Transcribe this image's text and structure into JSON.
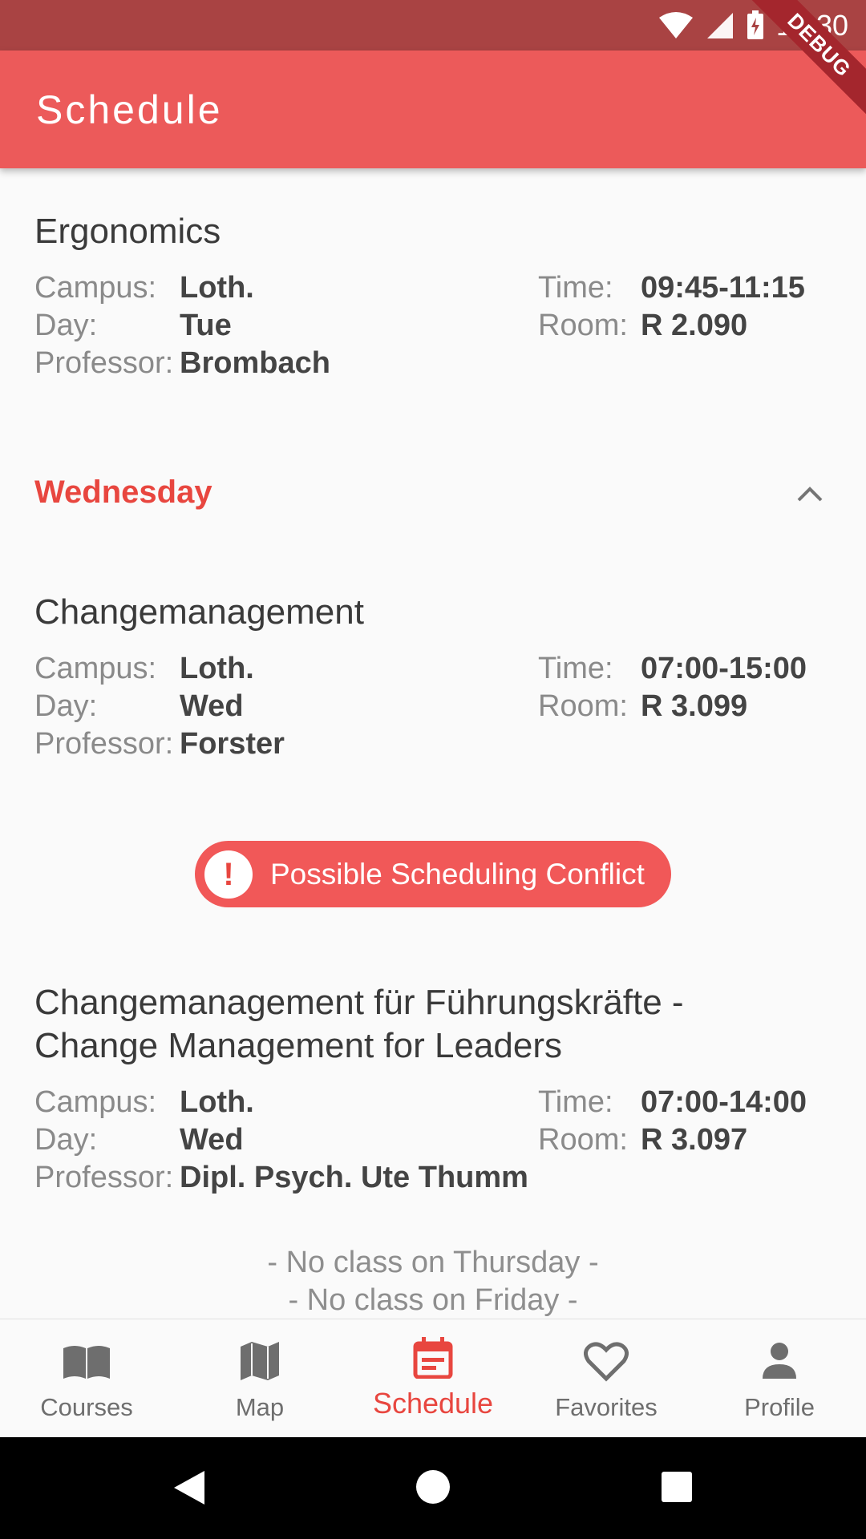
{
  "status_bar": {
    "time": "10:30",
    "debug_label": "DEBUG"
  },
  "app_bar": {
    "title": "Schedule"
  },
  "courses": [
    {
      "title": "Ergonomics",
      "campus_label": "Campus:",
      "campus": "Loth.",
      "day_label": "Day:",
      "day": "Tue",
      "professor_label": "Professor:",
      "professor": "Brombach",
      "time_label": "Time:",
      "time": "09:45-11:15",
      "room_label": "Room:",
      "room": "R 2.090"
    },
    {
      "title": "Changemanagement",
      "campus_label": "Campus:",
      "campus": "Loth.",
      "day_label": "Day:",
      "day": "Wed",
      "professor_label": "Professor:",
      "professor": "Forster",
      "time_label": "Time:",
      "time": "07:00-15:00",
      "room_label": "Room:",
      "room": "R 3.099"
    },
    {
      "title_line1": "Changemanagement für Führungskräfte -",
      "title_line2": "Change Management for Leaders",
      "campus_label": "Campus:",
      "campus": "Loth.",
      "day_label": "Day:",
      "day": "Wed",
      "professor_label": "Professor:",
      "professor": "Dipl. Psych. Ute  Thumm",
      "time_label": "Time:",
      "time": "07:00-14:00",
      "room_label": "Room:",
      "room": "R 3.097"
    }
  ],
  "day_section": {
    "label": "Wednesday"
  },
  "conflict": {
    "icon": "!",
    "text": "Possible Scheduling Conflict"
  },
  "no_class": [
    "- No class on Thursday -",
    "- No class on Friday -"
  ],
  "bottom_nav": [
    {
      "label": "Courses",
      "icon": "book-icon"
    },
    {
      "label": "Map",
      "icon": "map-icon"
    },
    {
      "label": "Schedule",
      "icon": "calendar-icon",
      "active": true
    },
    {
      "label": "Favorites",
      "icon": "heart-icon"
    },
    {
      "label": "Profile",
      "icon": "person-icon"
    }
  ],
  "colors": {
    "accent": "#e8463f",
    "app_bar": "#ec5a5a",
    "status_bar": "#a94343"
  }
}
